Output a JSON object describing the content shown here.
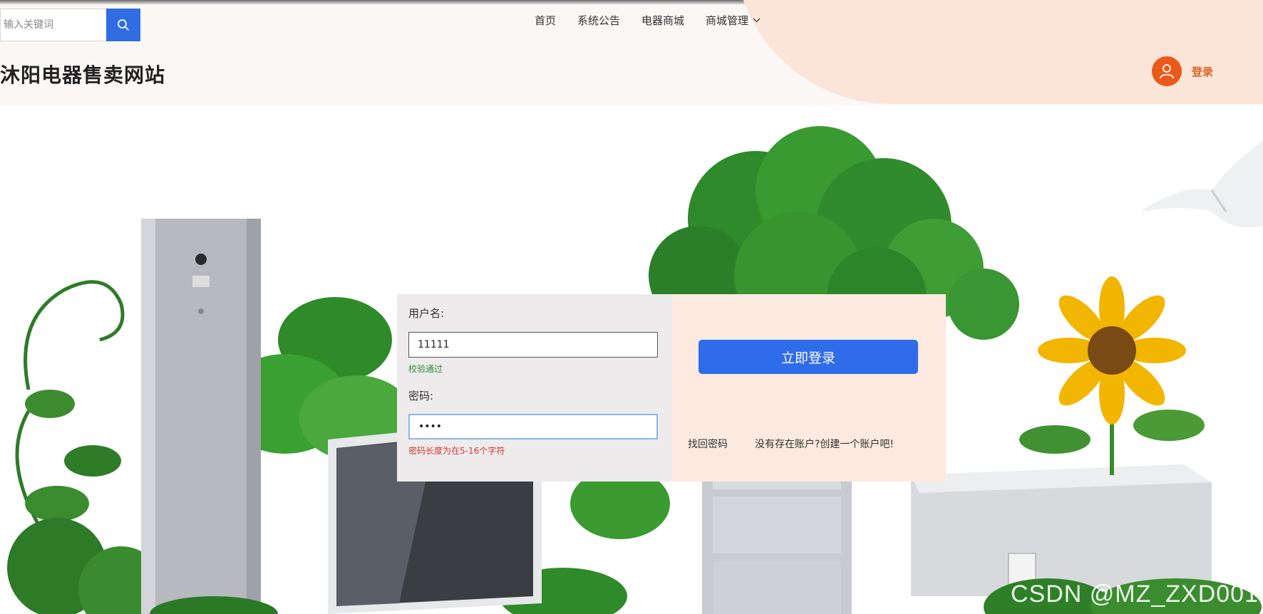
{
  "search": {
    "placeholder": "输入关键词"
  },
  "nav": {
    "home": "首页",
    "notice": "系统公告",
    "mall": "电器商城",
    "manage": "商城管理"
  },
  "site": {
    "title": "沐阳电器售卖网站"
  },
  "user": {
    "login_label": "登录"
  },
  "login": {
    "username_label": "用户名:",
    "username_value": "11111",
    "username_msg": "校验通过",
    "password_label": "密码:",
    "password_value": "••••",
    "password_msg": "密码长度为在5-16个字符",
    "submit_label": "立即登录",
    "forgot_label": "找回密码",
    "register_label": "没有存在账户?创建一个账户吧!"
  },
  "watermark": "CSDN @MZ_ZXD001",
  "colors": {
    "accent": "#2f6cea",
    "brand_orange": "#ea5a1b",
    "ok": "#2f8a3a",
    "error": "#d43a3a"
  }
}
